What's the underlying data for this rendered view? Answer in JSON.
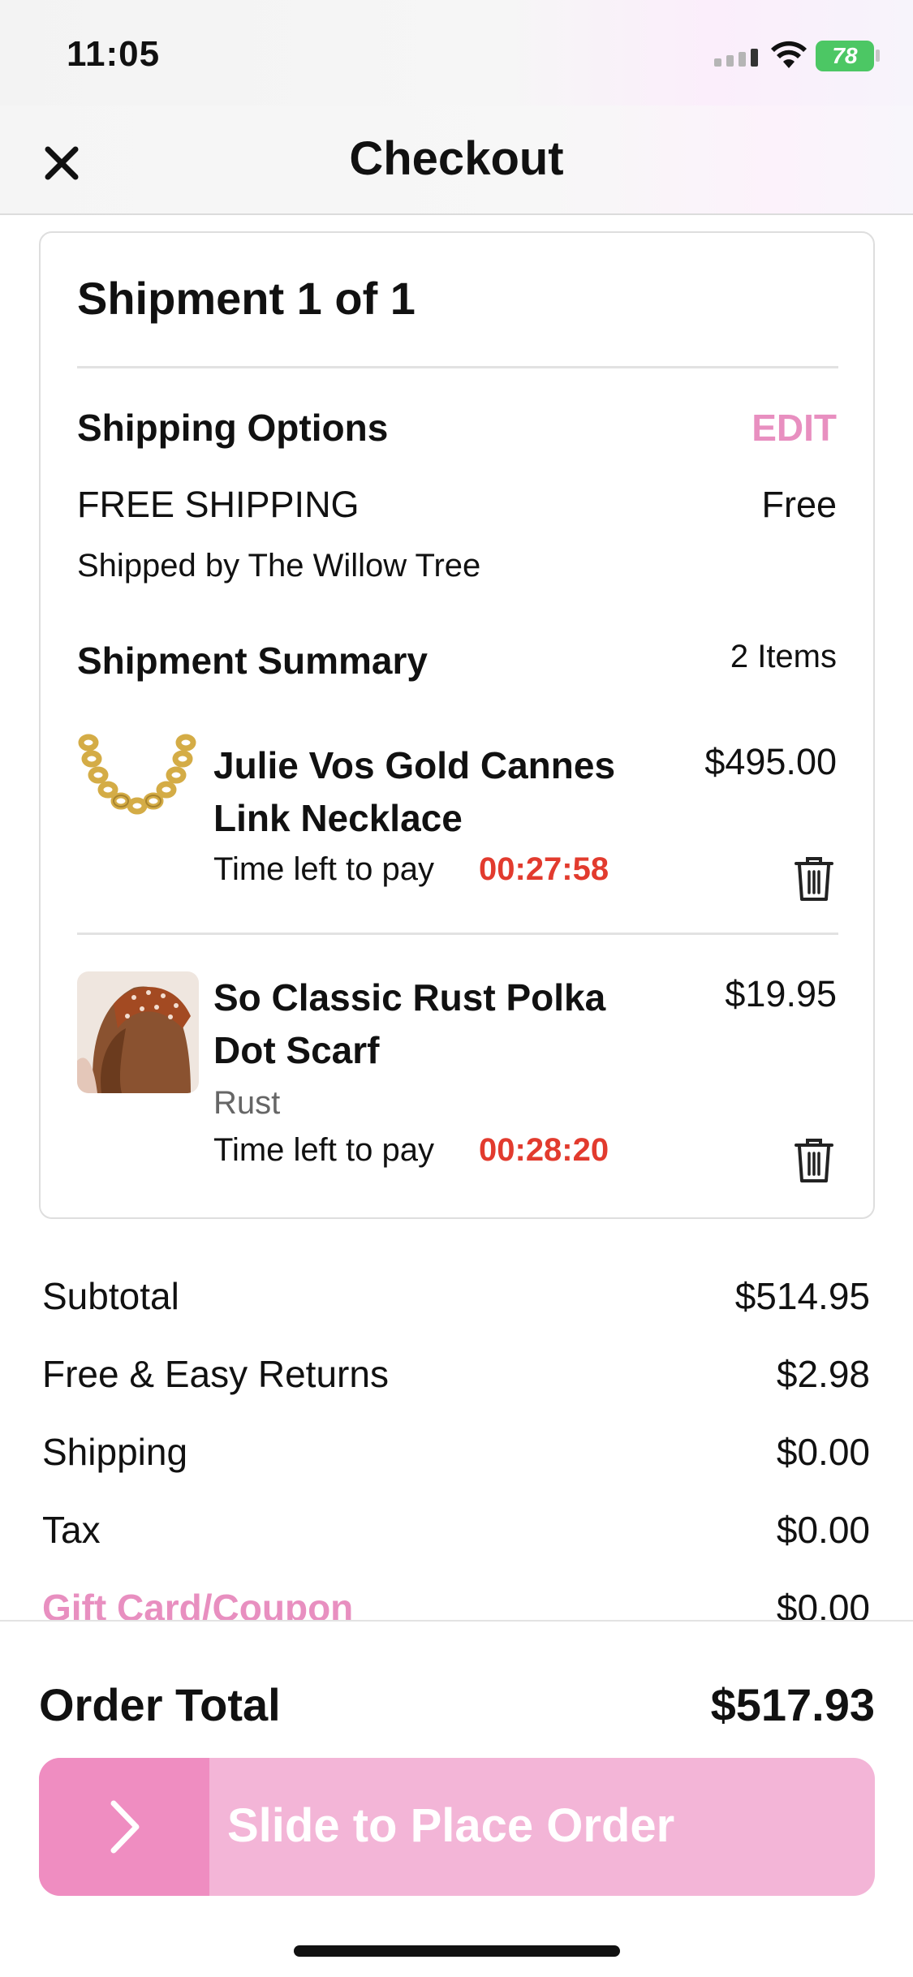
{
  "status_bar": {
    "time": "11:05",
    "battery": "78"
  },
  "nav": {
    "title": "Checkout",
    "close_icon": "close-icon"
  },
  "shipment": {
    "title": "Shipment 1 of 1",
    "shipping_options_label": "Shipping Options",
    "edit_label": "EDIT",
    "method": "FREE SHIPPING",
    "method_price": "Free",
    "shipped_by": "Shipped by The Willow Tree",
    "summary_label": "Shipment Summary",
    "item_count": "2 Items",
    "items": [
      {
        "name": "Julie Vos Gold Cannes Link Necklace",
        "price": "$495.00",
        "variant": "",
        "timer_label": "Time left to pay",
        "timer": "00:27:58"
      },
      {
        "name": "So Classic Rust Polka Dot Scarf",
        "price": "$19.95",
        "variant": "Rust",
        "timer_label": "Time left to pay",
        "timer": "00:28:20"
      }
    ]
  },
  "summary": {
    "rows": [
      {
        "label": "Subtotal",
        "value": "$514.95"
      },
      {
        "label": "Free & Easy Returns",
        "value": "$2.98"
      },
      {
        "label": "Shipping",
        "value": "$0.00"
      },
      {
        "label": "Tax",
        "value": "$0.00"
      },
      {
        "label": "Gift Card/Coupon",
        "value": "$0.00"
      }
    ]
  },
  "order_total": {
    "label": "Order Total",
    "value": "$517.93"
  },
  "slider": {
    "label": "Slide to Place Order"
  },
  "colors": {
    "accent": "#e88fc0",
    "timer": "#e23b2e",
    "slider_bg": "#f3b5d7",
    "slider_handle": "#ef8dc1"
  }
}
